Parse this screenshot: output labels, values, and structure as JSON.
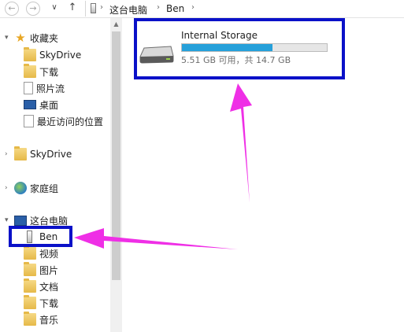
{
  "address": {
    "back_glyph": "←",
    "forward_glyph": "→",
    "dropdown_glyph": "∨",
    "up_glyph": "↑",
    "path": [
      "这台电脑",
      "Ben"
    ]
  },
  "sidebar": {
    "items": [
      {
        "label": "收藏夹",
        "icon": "star-icon"
      },
      {
        "label": "SkyDrive",
        "icon": "folder-icon"
      },
      {
        "label": "下载",
        "icon": "download-folder-icon"
      },
      {
        "label": "照片流",
        "icon": "document-icon"
      },
      {
        "label": "桌面",
        "icon": "desktop-icon"
      },
      {
        "label": "最近访问的位置",
        "icon": "recent-places-icon"
      },
      {
        "label": "SkyDrive",
        "icon": "skydrive-folder-icon"
      },
      {
        "label": "家庭组",
        "icon": "homegroup-icon"
      },
      {
        "label": "这台电脑",
        "icon": "computer-icon"
      },
      {
        "label": "Ben",
        "icon": "device-icon"
      },
      {
        "label": "视频",
        "icon": "videos-folder-icon"
      },
      {
        "label": "图片",
        "icon": "pictures-folder-icon"
      },
      {
        "label": "文档",
        "icon": "documents-folder-icon"
      },
      {
        "label": "下载",
        "icon": "downloads-folder-icon"
      },
      {
        "label": "音乐",
        "icon": "music-folder-icon"
      }
    ]
  },
  "storage": {
    "name": "Internal Storage",
    "space_text": "5.51 GB 可用，共 14.7 GB",
    "used_fraction": 0.625
  },
  "annotations": {
    "highlight_color": "#0a11c8",
    "arrow_color": "#ef2fe6"
  }
}
